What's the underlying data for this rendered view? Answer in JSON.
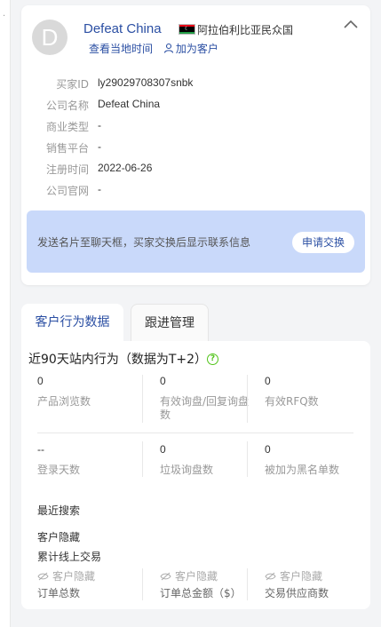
{
  "company": {
    "avatar_letter": "D",
    "name": "Defeat China",
    "country": "阿拉伯利比亚民众国",
    "local_time_link": "查看当地时间",
    "add_customer_link": "加为客户"
  },
  "info": [
    {
      "label": "买家ID",
      "value": "ly29029708307snbk"
    },
    {
      "label": "公司名称",
      "value": "Defeat China"
    },
    {
      "label": "商业类型",
      "value": "-"
    },
    {
      "label": "销售平台",
      "value": "-"
    },
    {
      "label": "注册时间",
      "value": "2022-06-26"
    },
    {
      "label": "公司官网",
      "value": "-"
    }
  ],
  "exchange": {
    "text": "发送名片至聊天框，买家交换后显示联系信息",
    "button": "申请交换"
  },
  "tabs": [
    {
      "label": "客户行为数据",
      "active": true
    },
    {
      "label": "跟进管理",
      "active": false
    }
  ],
  "behavior": {
    "title": "近90天站内行为（数据为T+2）",
    "help_icon": "?",
    "stats": [
      {
        "value": "0",
        "label": "产品浏览数"
      },
      {
        "value": "0",
        "label": "有效询盘/回复询盘数"
      },
      {
        "value": "0",
        "label": "有效RFQ数"
      },
      {
        "value": "--",
        "label": "登录天数"
      },
      {
        "value": "0",
        "label": "垃圾询盘数"
      },
      {
        "value": "0",
        "label": "被加为黑名单数"
      }
    ],
    "recent_search_label": "最近搜索",
    "recent_search_value": "客户隐藏",
    "online_trade_label": "累计线上交易",
    "hidden": [
      {
        "status": "客户隐藏",
        "label": "订单总数"
      },
      {
        "status": "客户隐藏",
        "label": "订单总金额（$）"
      },
      {
        "status": "客户隐藏",
        "label": "交易供应商数"
      }
    ]
  },
  "colors": {
    "accent": "#2b4fa3",
    "exchange_bg": "#c9d9fa",
    "help_green": "#52c41a"
  }
}
